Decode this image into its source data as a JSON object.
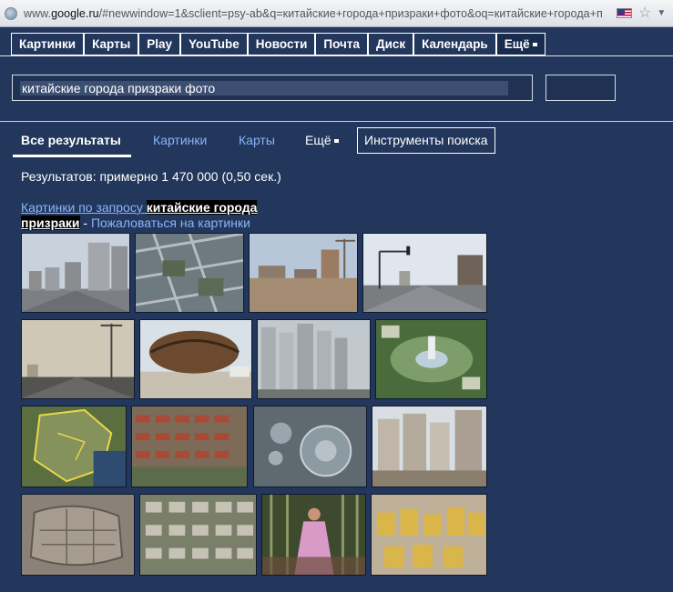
{
  "address_bar": {
    "url_prefix": "www.",
    "url_domain": "google.ru",
    "url_rest": "/#newwindow=1&sclient=psy-ab&q=китайские+города+призраки+фото&oq=китайские+города+п"
  },
  "topnav": {
    "items": [
      "Картинки",
      "Карты",
      "Play",
      "YouTube",
      "Новости",
      "Почта",
      "Диск",
      "Календарь"
    ],
    "more": "Ещё"
  },
  "search": {
    "value": "китайские города призраки фото",
    "placeholder": ""
  },
  "tabs": {
    "all": "Все результаты",
    "images": "Картинки",
    "maps": "Карты",
    "more": "Ещё",
    "tools": "Инструменты поиска"
  },
  "stats": "Результатов: примерно 1 470 000 (0,50 сек.)",
  "images_block": {
    "prefix": "Картинки по запросу ",
    "query_line1": "китайские города",
    "query_line2": "призраки",
    "separator": " - ",
    "report": "Пожаловаться на картинки"
  },
  "thumbnails": [
    {
      "row": 1,
      "subject": "empty street with apartment towers"
    },
    {
      "row": 1,
      "subject": "aerial view of city blocks"
    },
    {
      "row": 1,
      "subject": "empty plaza with construction cranes"
    },
    {
      "row": 1,
      "subject": "wide empty road with traffic lights"
    },
    {
      "row": 2,
      "subject": "highway with street lamps in haze"
    },
    {
      "row": 2,
      "subject": "bronze museum building"
    },
    {
      "row": 2,
      "subject": "high-rise residential towers"
    },
    {
      "row": 2,
      "subject": "aerial green park with fountain"
    },
    {
      "row": 3,
      "subject": "satellite map of region"
    },
    {
      "row": 3,
      "subject": "rows of red-roof houses"
    },
    {
      "row": 3,
      "subject": "aerial view of circular complex"
    },
    {
      "row": 3,
      "subject": "apartment blocks under construction"
    },
    {
      "row": 4,
      "subject": "satellite view of walled town"
    },
    {
      "row": 4,
      "subject": "aerial residential villas"
    },
    {
      "row": 4,
      "subject": "woman in pink dress in bamboo forest"
    },
    {
      "row": 4,
      "subject": "yellow apartment buildings"
    }
  ]
}
